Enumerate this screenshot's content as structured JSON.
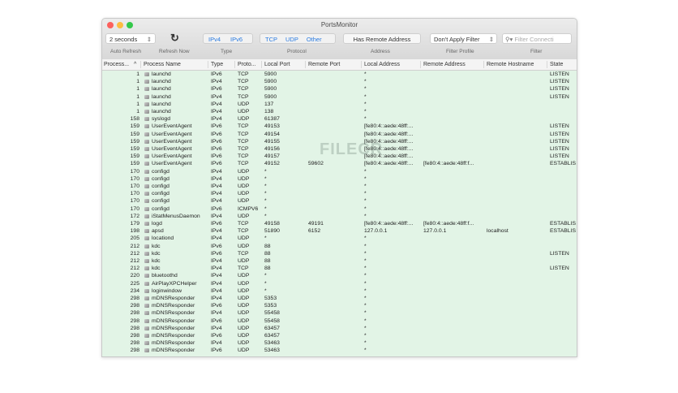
{
  "window": {
    "title": "PortsMonitor"
  },
  "toolbar": {
    "refresh_interval": "2 seconds",
    "type_ipv4": "IPv4",
    "type_ipv6": "IPv6",
    "proto_tcp": "TCP",
    "proto_udp": "UDP",
    "proto_other": "Other",
    "has_remote": "Has Remote Address",
    "filter_profile": "Don't Apply Filter",
    "filter_placeholder": "Filter Connecti",
    "labels": {
      "auto_refresh": "Auto Refresh",
      "refresh_now": "Refresh Now",
      "type": "Type",
      "protocol": "Protocol",
      "address": "Address",
      "filter_profile": "Filter Profile",
      "filter": "Filter"
    }
  },
  "columns": [
    "Process...",
    "Process Name",
    "Type",
    "Proto...",
    "Local Port",
    "Remote Port",
    "Local Address",
    "Remote Address",
    "Remote Hostname",
    "State"
  ],
  "watermark": "FILECR",
  "rows": [
    [
      "1",
      "launchd",
      "IPv6",
      "TCP",
      "5900",
      "",
      "*",
      "",
      "",
      "LISTEN"
    ],
    [
      "1",
      "launchd",
      "IPv4",
      "TCP",
      "5900",
      "",
      "*",
      "",
      "",
      "LISTEN"
    ],
    [
      "1",
      "launchd",
      "IPv6",
      "TCP",
      "5900",
      "",
      "*",
      "",
      "",
      "LISTEN"
    ],
    [
      "1",
      "launchd",
      "IPv4",
      "TCP",
      "5900",
      "",
      "*",
      "",
      "",
      "LISTEN"
    ],
    [
      "1",
      "launchd",
      "IPv4",
      "UDP",
      "137",
      "",
      "*",
      "",
      "",
      ""
    ],
    [
      "1",
      "launchd",
      "IPv4",
      "UDP",
      "138",
      "",
      "*",
      "",
      "",
      ""
    ],
    [
      "158",
      "syslogd",
      "IPv4",
      "UDP",
      "61387",
      "",
      "*",
      "",
      "",
      ""
    ],
    [
      "159",
      "UserEventAgent",
      "IPv6",
      "TCP",
      "49153",
      "",
      "[fe80:4::aede:48ff:...",
      "",
      "",
      "LISTEN"
    ],
    [
      "159",
      "UserEventAgent",
      "IPv6",
      "TCP",
      "49154",
      "",
      "[fe80:4::aede:48ff:...",
      "",
      "",
      "LISTEN"
    ],
    [
      "159",
      "UserEventAgent",
      "IPv6",
      "TCP",
      "49155",
      "",
      "[fe80:4::aede:48ff:...",
      "",
      "",
      "LISTEN"
    ],
    [
      "159",
      "UserEventAgent",
      "IPv6",
      "TCP",
      "49156",
      "",
      "[fe80:4::aede:48ff:...",
      "",
      "",
      "LISTEN"
    ],
    [
      "159",
      "UserEventAgent",
      "IPv6",
      "TCP",
      "49157",
      "",
      "[fe80:4::aede:48ff:...",
      "",
      "",
      "LISTEN"
    ],
    [
      "159",
      "UserEventAgent",
      "IPv6",
      "TCP",
      "49152",
      "59602",
      "[fe80:4::aede:48ff:...",
      "[fe80:4::aede:48ff:f...",
      "",
      "ESTABLIS"
    ],
    [
      "170",
      "configd",
      "IPv4",
      "UDP",
      "*",
      "",
      "*",
      "",
      "",
      ""
    ],
    [
      "170",
      "configd",
      "IPv4",
      "UDP",
      "*",
      "",
      "*",
      "",
      "",
      ""
    ],
    [
      "170",
      "configd",
      "IPv4",
      "UDP",
      "*",
      "",
      "*",
      "",
      "",
      ""
    ],
    [
      "170",
      "configd",
      "IPv4",
      "UDP",
      "*",
      "",
      "*",
      "",
      "",
      ""
    ],
    [
      "170",
      "configd",
      "IPv4",
      "UDP",
      "*",
      "",
      "*",
      "",
      "",
      ""
    ],
    [
      "170",
      "configd",
      "IPv6",
      "ICMPV6",
      "*",
      "",
      "*",
      "",
      "",
      ""
    ],
    [
      "172",
      "iStatMenusDaemon",
      "IPv4",
      "UDP",
      "*",
      "",
      "*",
      "",
      "",
      ""
    ],
    [
      "179",
      "logd",
      "IPv6",
      "TCP",
      "49158",
      "49191",
      "[fe80:4::aede:48ff:...",
      "[fe80:4::aede:48ff:f...",
      "",
      "ESTABLIS"
    ],
    [
      "198",
      "apsd",
      "IPv4",
      "TCP",
      "51890",
      "6152",
      "127.0.0.1",
      "127.0.0.1",
      "localhost",
      "ESTABLIS"
    ],
    [
      "205",
      "locationd",
      "IPv4",
      "UDP",
      "*",
      "",
      "*",
      "",
      "",
      ""
    ],
    [
      "212",
      "kdc",
      "IPv6",
      "UDP",
      "88",
      "",
      "*",
      "",
      "",
      ""
    ],
    [
      "212",
      "kdc",
      "IPv6",
      "TCP",
      "88",
      "",
      "*",
      "",
      "",
      "LISTEN"
    ],
    [
      "212",
      "kdc",
      "IPv4",
      "UDP",
      "88",
      "",
      "*",
      "",
      "",
      ""
    ],
    [
      "212",
      "kdc",
      "IPv4",
      "TCP",
      "88",
      "",
      "*",
      "",
      "",
      "LISTEN"
    ],
    [
      "220",
      "bluetoothd",
      "IPv4",
      "UDP",
      "*",
      "",
      "*",
      "",
      "",
      ""
    ],
    [
      "225",
      "AirPlayXPCHelper",
      "IPv4",
      "UDP",
      "*",
      "",
      "*",
      "",
      "",
      ""
    ],
    [
      "234",
      "loginwindow",
      "IPv4",
      "UDP",
      "*",
      "",
      "*",
      "",
      "",
      ""
    ],
    [
      "298",
      "mDNSResponder",
      "IPv4",
      "UDP",
      "5353",
      "",
      "*",
      "",
      "",
      ""
    ],
    [
      "298",
      "mDNSResponder",
      "IPv6",
      "UDP",
      "5353",
      "",
      "*",
      "",
      "",
      ""
    ],
    [
      "298",
      "mDNSResponder",
      "IPv4",
      "UDP",
      "55458",
      "",
      "*",
      "",
      "",
      ""
    ],
    [
      "298",
      "mDNSResponder",
      "IPv6",
      "UDP",
      "55458",
      "",
      "*",
      "",
      "",
      ""
    ],
    [
      "298",
      "mDNSResponder",
      "IPv4",
      "UDP",
      "63457",
      "",
      "*",
      "",
      "",
      ""
    ],
    [
      "298",
      "mDNSResponder",
      "IPv6",
      "UDP",
      "63457",
      "",
      "*",
      "",
      "",
      ""
    ],
    [
      "298",
      "mDNSResponder",
      "IPv4",
      "UDP",
      "53463",
      "",
      "*",
      "",
      "",
      ""
    ],
    [
      "298",
      "mDNSResponder",
      "IPv6",
      "UDP",
      "53463",
      "",
      "*",
      "",
      "",
      ""
    ]
  ]
}
